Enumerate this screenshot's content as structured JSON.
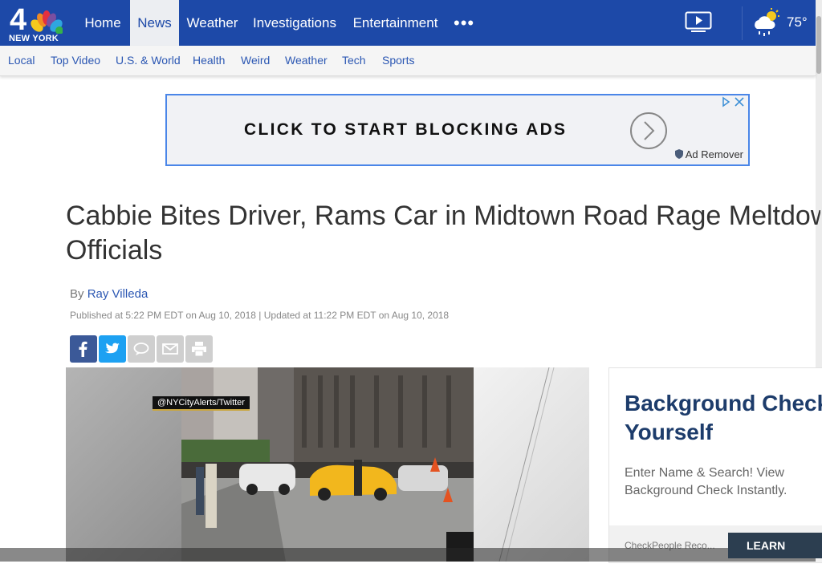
{
  "brand": {
    "logo_number": "4",
    "logo_city": "NEW YORK"
  },
  "nav": {
    "items": [
      {
        "label": "Home"
      },
      {
        "label": "News"
      },
      {
        "label": "Weather"
      },
      {
        "label": "Investigations"
      },
      {
        "label": "Entertainment"
      }
    ],
    "more_label": "•••",
    "temperature": "75°"
  },
  "subnav": {
    "items": [
      {
        "label": "Local"
      },
      {
        "label": "Top Video"
      },
      {
        "label": "U.S. & World"
      },
      {
        "label": "Health"
      },
      {
        "label": "Weird"
      },
      {
        "label": "Weather"
      },
      {
        "label": "Tech"
      },
      {
        "label": "Sports"
      }
    ]
  },
  "ad_banner": {
    "text": "CLICK TO START BLOCKING ADS",
    "brand": "Ad Remover"
  },
  "article": {
    "headline_line1": "Cabbie Bites Driver, Rams Car in Midtown Road Rage Meltdown:",
    "headline_line2": "Officials",
    "by_prefix": "By",
    "author": "Ray Villeda",
    "published": "Published at 5:22 PM EDT on Aug 10, 2018 | Updated at 11:22 PM EDT on Aug 10, 2018"
  },
  "video": {
    "caption_tag": "@NYCityAlerts/Twitter"
  },
  "side_ad": {
    "title": "Background Check Yourself",
    "description": "Enter Name & Search! View Background Check Instantly.",
    "brand": "CheckPeople Reco...",
    "button_label": "LEARN MORE"
  },
  "colors": {
    "nav_bg": "#1d49a8",
    "link": "#2b57b3",
    "facebook": "#3b5998",
    "twitter": "#1da1f2"
  }
}
